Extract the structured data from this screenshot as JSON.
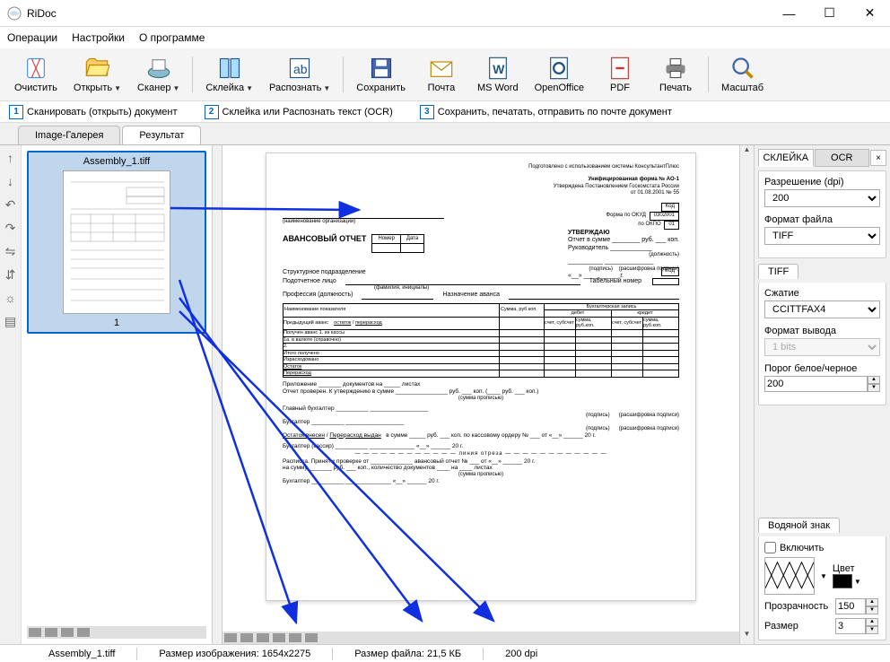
{
  "title": "RiDoc",
  "menu": [
    "Операции",
    "Настройки",
    "О программе"
  ],
  "toolbar": [
    {
      "name": "clear",
      "label": "Очистить"
    },
    {
      "name": "open",
      "label": "Открыть",
      "dropdown": true
    },
    {
      "name": "scanner",
      "label": "Сканер",
      "dropdown": true
    },
    {
      "name": "stitch",
      "label": "Склейка",
      "dropdown": true
    },
    {
      "name": "recognize",
      "label": "Распознать",
      "dropdown": true
    },
    {
      "name": "save",
      "label": "Сохранить"
    },
    {
      "name": "mail",
      "label": "Почта"
    },
    {
      "name": "word",
      "label": "MS Word"
    },
    {
      "name": "openoffice",
      "label": "OpenOffice"
    },
    {
      "name": "pdf",
      "label": "PDF"
    },
    {
      "name": "print",
      "label": "Печать"
    },
    {
      "name": "zoom",
      "label": "Масштаб"
    }
  ],
  "steps": [
    {
      "n": "1",
      "text": "Сканировать (открыть) документ"
    },
    {
      "n": "2",
      "text": "Склейка или Распознать текст (OCR)"
    },
    {
      "n": "3",
      "text": "Сохранить, печатать, отправить по почте документ"
    }
  ],
  "tabs": {
    "gallery": "Image-Галерея",
    "result": "Результат"
  },
  "thumb": {
    "name": "Assembly_1.tiff",
    "num": "1"
  },
  "doc": {
    "header1": "Подготовлено с использованием системы КонсультантПлюс",
    "header2": "Унифицированная форма № АО-1",
    "header3": "Утверждена Постановлением Госкомстата России",
    "header4": "от 01.08.2001 № 55",
    "code_label": "Код",
    "code_okud_label": "Форма по ОКУД",
    "code_okud": "0302001",
    "code_okpo_label": "по ОКПО",
    "code_okpo": "01",
    "org_label": "(наименование организации)",
    "approve": "УТВЕРЖДАЮ",
    "report_sum": "Отчет в сумме",
    "rub": "руб.",
    "kop": "коп.",
    "head": "Руководитель",
    "position_hint": "(должность)",
    "sign_hint": "(подпись)",
    "sign_decrypt": "(расшифровка подписи)",
    "title": "АВАНСОВЫЙ ОТЧЕТ",
    "num_label": "Номер",
    "date_label": "Дата",
    "unit": "Структурное подразделение",
    "person": "Подотчетное лицо",
    "tab_num": "Табельный номер",
    "fio_hint": "(фамилия, инициалы)",
    "prof": "Профессия (должность)",
    "purpose": "Назначение аванса",
    "indicators": "Наименование показателя",
    "sum": "Сумма, руб.коп.",
    "accounting": "Бухгалтерская запись",
    "debit": "дебет",
    "credit": "кредит",
    "prev_advance": "Предыдущий аванс",
    "balance": "остаток",
    "overrun": "перерасход",
    "account_sub": "счет, субсчет",
    "sum_rubkop": "сумма, руб.коп.",
    "got_advance": "Получен аванс 1. из кассы",
    "currency": "1а. в валюте (справочно)",
    "total_got": "Итого получено",
    "spent": "Израсходовано",
    "rest": "Остаток",
    "over": "Перерасход",
    "attachment": "Приложение",
    "docs_on": "документов на",
    "sheets": "листах",
    "report_verified": "Отчет проверен. К утверждению в сумме",
    "sum_text": "(сумма прописью)",
    "chief_acc": "Главный бухгалтер",
    "accountant": "Бухгалтер",
    "rest_paid": "Остаток внесен",
    "over_paid": "Перерасход выдан",
    "in_sum": "в сумме",
    "cash_order": "коп. по кассовому ордеру №",
    "from": "от",
    "year": "20    г.",
    "accountant_cashier": "Бухгалтер (кассир)",
    "cut_line": "линия отреза",
    "receipt": "Расписка. Принят к проверке от",
    "advance_report": "авансовый отчет №",
    "for_sum": "на сумму",
    "docs_count": "коп., количество документов",
    "on": "на",
    "g": "г."
  },
  "right_panel": {
    "tabs": {
      "stitch": "СКЛЕЙКА",
      "ocr": "OCR"
    },
    "resolution_label": "Разрешение (dpi)",
    "resolution": "200",
    "format_label": "Формат файла",
    "format": "TIFF",
    "tiff_tab": "TIFF",
    "compression_label": "Сжатие",
    "compression": "CCITTFAX4",
    "output_label": "Формат вывода",
    "output": "1 bits",
    "threshold_label": "Порог белое/черное",
    "threshold": "200",
    "watermark_tab": "Водяной знак",
    "wm_enable": "Включить",
    "wm_color": "Цвет",
    "wm_opacity_label": "Прозрачность",
    "wm_opacity": "150",
    "wm_size_label": "Размер",
    "wm_size": "3"
  },
  "status": {
    "file": "Assembly_1.tiff",
    "dims_label": "Размер изображения:",
    "dims": "1654х2275",
    "filesize_label": "Размер файла:",
    "filesize": "21,5 КБ",
    "dpi": "200 dpi"
  }
}
